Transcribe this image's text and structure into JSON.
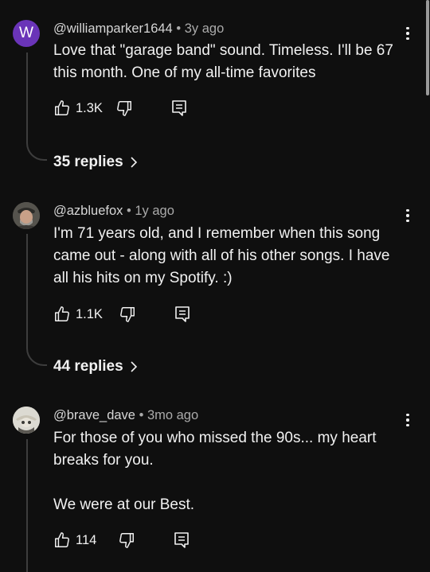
{
  "comments": [
    {
      "avatar_letter": "W",
      "handle": "@williamparker1644",
      "separator": "•",
      "age": "3y ago",
      "text": "Love that \"garage band\" sound. Timeless. I'll be 67 this month. One of my all-time favorites",
      "likes": "1.3K",
      "replies_label": "35 replies"
    },
    {
      "handle": "@azbluefox",
      "separator": "•",
      "age": "1y ago",
      "text": "I'm 71 years old, and I remember when this song came out - along with all of his other songs.  I have all his hits on my Spotify.  :)",
      "likes": "1.1K",
      "replies_label": "44 replies"
    },
    {
      "handle": "@brave_dave",
      "separator": "•",
      "age": "3mo ago",
      "text": "For those of you who missed the 90s... my heart breaks for you.\n\nWe were at our Best.",
      "likes": "114"
    }
  ],
  "colors": {
    "background": "#0f0f0f",
    "avatar_purple": "#6a34b8",
    "thread_line": "#3d3d3d"
  }
}
